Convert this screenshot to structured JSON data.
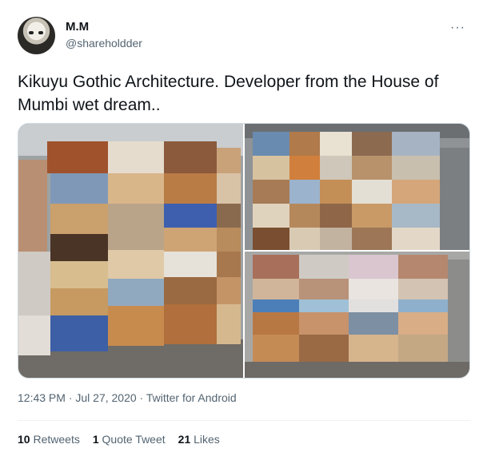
{
  "user": {
    "display_name": "M.M",
    "handle": "@shareholdder"
  },
  "more_icon": "more-horizontal-icon",
  "tweet": {
    "text": "Kikuyu Gothic Architecture. Developer from the House of Mumbi wet dream..",
    "timestamp": "12:43 PM · Jul 27, 2020 · ",
    "source": "Twitter for Android"
  },
  "stats": {
    "retweets_count": "10",
    "retweets_label": "Retweets",
    "quotes_count": "1",
    "quotes_label": "Quote Tweet",
    "likes_count": "21",
    "likes_label": "Likes"
  },
  "colors": {
    "text": "#0f1419",
    "secondary": "#536471",
    "border": "#cfd9de"
  }
}
